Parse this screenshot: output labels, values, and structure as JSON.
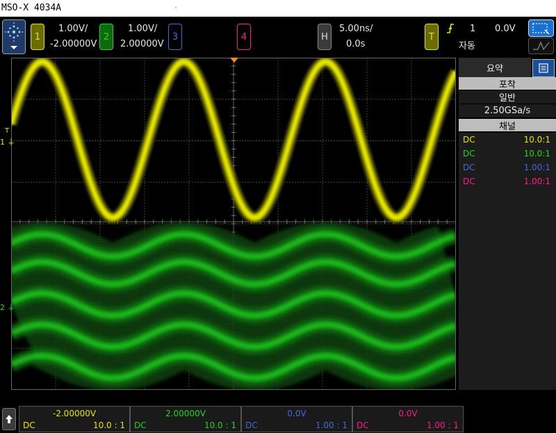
{
  "window": {
    "title": "MSO-X 4034A"
  },
  "colors": {
    "ch1": "#e6e600",
    "ch2": "#22d422",
    "ch3": "#4169e1",
    "ch4": "#ff1a8c",
    "grid": "#444",
    "trigger": "#ff8c00"
  },
  "toolbar": {
    "ch1": {
      "number": "1",
      "scale": "1.00V/",
      "offset": "-2.00000V"
    },
    "ch2": {
      "number": "2",
      "scale": "1.00V/",
      "offset": "2.00000V"
    },
    "ch3": {
      "number": "3"
    },
    "ch4": {
      "number": "4"
    },
    "horizontal": {
      "key": "H",
      "scale": "5.00ns/",
      "delay": "0.0s"
    },
    "trigger": {
      "key": "T",
      "source": "1",
      "level": "0.0V",
      "mode": "자동"
    }
  },
  "screen": {
    "ch1_marker": "1",
    "ch2_marker": "2",
    "trig_marker": "T"
  },
  "sidebar": {
    "tab_summary": "요약",
    "acq_header": "포착",
    "acq_mode": "일반",
    "sample_rate": "2.50GSa/s",
    "channel_header": "채널",
    "channels": [
      {
        "coupling": "DC",
        "probe": "10.0:1"
      },
      {
        "coupling": "DC",
        "probe": "10.0:1"
      },
      {
        "coupling": "DC",
        "probe": "1.00:1"
      },
      {
        "coupling": "DC",
        "probe": "1.00:1"
      }
    ]
  },
  "bottom": [
    {
      "offset": "-2.00000V",
      "coupling": "DC",
      "probe": "10.0 : 1"
    },
    {
      "offset": "2.00000V",
      "coupling": "DC",
      "probe": "10.0 : 1"
    },
    {
      "offset": "0.0V",
      "coupling": "DC",
      "probe": "1.00 : 1"
    },
    {
      "offset": "0.0V",
      "coupling": "DC",
      "probe": "1.00 : 1"
    }
  ]
}
